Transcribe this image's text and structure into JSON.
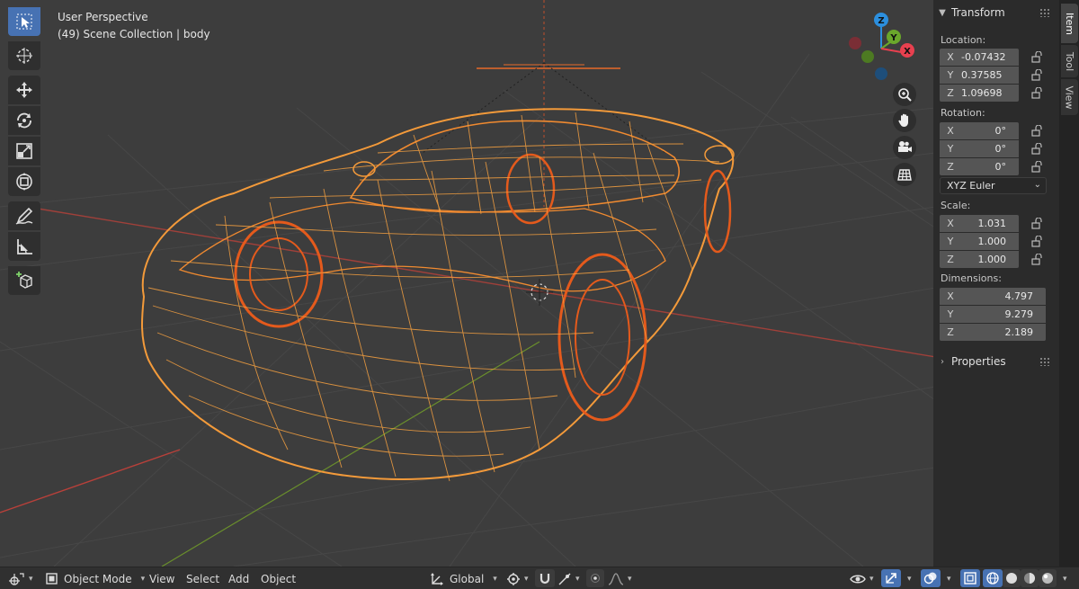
{
  "viewport": {
    "perspective_label": "User Perspective",
    "collection_label": "(49) Scene Collection | body"
  },
  "toolbar": {
    "tools": [
      "select-box-icon",
      "cursor-icon",
      "move-icon",
      "rotate-icon",
      "scale-icon",
      "transform-icon",
      "annotate-icon",
      "measure-icon",
      "add-cube-icon"
    ],
    "active_tool": "select-box-icon"
  },
  "gizmo": {
    "axis_x": "X",
    "axis_y": "Y",
    "axis_z": "Z",
    "colors": {
      "x": "#e8404f",
      "y": "#6aa72b",
      "z": "#2c8fde"
    }
  },
  "nav_buttons": [
    "zoom-icon",
    "hand-pan-icon",
    "camera-icon",
    "grid-ortho-icon"
  ],
  "sidebar": {
    "tabs": [
      "Item",
      "Tool",
      "View"
    ],
    "active_tab": "Item",
    "transform_header": "Transform",
    "location_label": "Location:",
    "location": [
      {
        "axis": "X",
        "value": "-0.07432"
      },
      {
        "axis": "Y",
        "value": "0.37585"
      },
      {
        "axis": "Z",
        "value": "1.09698"
      }
    ],
    "rotation_label": "Rotation:",
    "rotation": [
      {
        "axis": "X",
        "value": "0°"
      },
      {
        "axis": "Y",
        "value": "0°"
      },
      {
        "axis": "Z",
        "value": "0°"
      }
    ],
    "rotation_mode": "XYZ Euler",
    "scale_label": "Scale:",
    "scale": [
      {
        "axis": "X",
        "value": "1.031"
      },
      {
        "axis": "Y",
        "value": "1.000"
      },
      {
        "axis": "Z",
        "value": "1.000"
      }
    ],
    "dimensions_label": "Dimensions:",
    "dimensions": [
      {
        "axis": "X",
        "value": "4.797"
      },
      {
        "axis": "Y",
        "value": "9.279"
      },
      {
        "axis": "Z",
        "value": "2.189"
      }
    ],
    "properties_header": "Properties"
  },
  "footer": {
    "mode": "Object Mode",
    "menus": [
      "View",
      "Select",
      "Add",
      "Object"
    ],
    "orientation": "Global"
  },
  "colors": {
    "accent": "#4772b3",
    "wire": "#f08a30",
    "wire_dark": "#d9521a",
    "axis_x": "#b8403a",
    "axis_y": "#6a8f2c"
  }
}
